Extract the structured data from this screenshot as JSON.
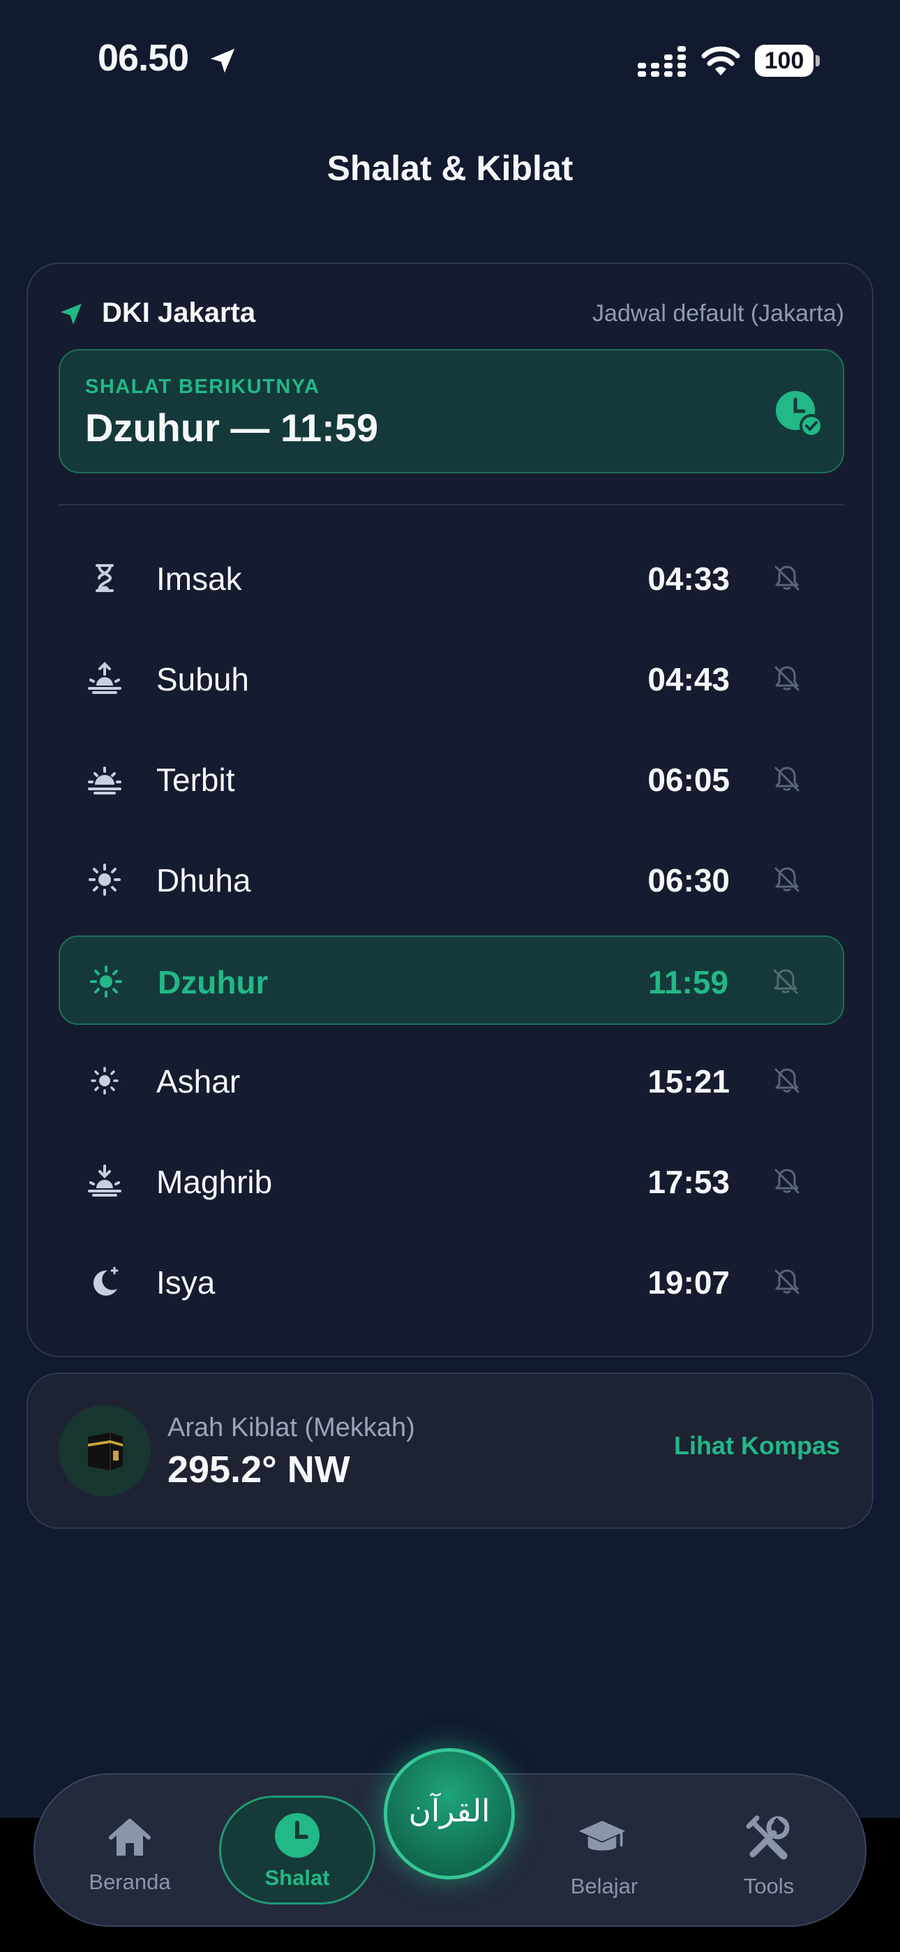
{
  "status_bar": {
    "time": "06.50",
    "battery": "100"
  },
  "header": {
    "title": "Shalat & Kiblat"
  },
  "location": {
    "name": "DKI Jakarta",
    "source": "Jadwal default (Jakarta)"
  },
  "next_prayer": {
    "label": "SHALAT BERIKUTNYA",
    "value": "Dzuhur — 11:59"
  },
  "prayers": [
    {
      "name": "Imsak",
      "time": "04:33",
      "icon": "hourglass-icon",
      "active": false
    },
    {
      "name": "Subuh",
      "time": "04:43",
      "icon": "sunrise-icon",
      "active": false
    },
    {
      "name": "Terbit",
      "time": "06:05",
      "icon": "sun-horizon-icon",
      "active": false
    },
    {
      "name": "Dhuha",
      "time": "06:30",
      "icon": "sun-icon",
      "active": false
    },
    {
      "name": "Dzuhur",
      "time": "11:59",
      "icon": "sun-icon",
      "active": true
    },
    {
      "name": "Ashar",
      "time": "15:21",
      "icon": "sun-small-icon",
      "active": false
    },
    {
      "name": "Maghrib",
      "time": "17:53",
      "icon": "sunset-icon",
      "active": false
    },
    {
      "name": "Isya",
      "time": "19:07",
      "icon": "moon-stars-icon",
      "active": false
    }
  ],
  "qibla": {
    "label": "Arah Kiblat (Mekkah)",
    "value": "295.2° NW",
    "link": "Lihat Kompas"
  },
  "nav": {
    "items": [
      {
        "label": "Beranda",
        "icon": "home-icon"
      },
      {
        "label": "Shalat",
        "icon": "clock-icon",
        "active": true
      },
      {
        "label": "Belajar",
        "icon": "graduation-cap-icon"
      },
      {
        "label": "Tools",
        "icon": "tools-icon"
      }
    ],
    "center_label": "القرآن"
  },
  "colors": {
    "background": "#111a2e",
    "accent": "#22b887",
    "card": "#161c2f",
    "active_row": "#15393a"
  }
}
